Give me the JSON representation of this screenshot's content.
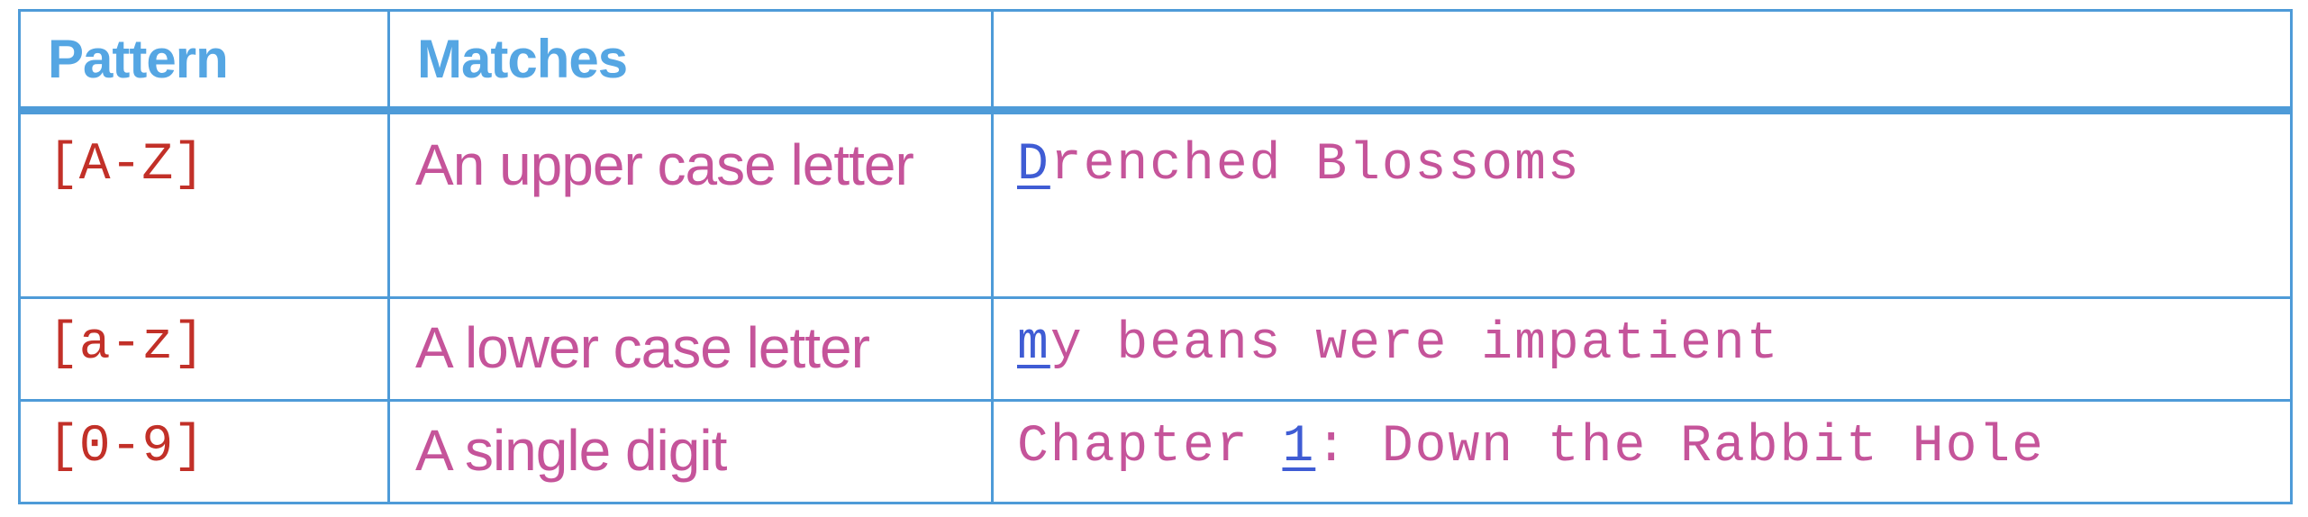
{
  "table": {
    "headers": [
      "Pattern",
      "Matches",
      ""
    ],
    "rows": [
      {
        "pattern": "[A-Z]",
        "matches": "An upper case letter",
        "example_match": "D",
        "example_rest": "renched Blossoms"
      },
      {
        "pattern": "[a-z]",
        "matches": "A lower case letter",
        "example_match": "m",
        "example_rest": "y beans were impatient"
      },
      {
        "pattern": "[0-9]",
        "matches": "A single digit",
        "example_before": "Chapter ",
        "example_match": "1",
        "example_rest": ": Down the Rabbit Hole"
      }
    ]
  },
  "colors": {
    "border": "#4e9bd8",
    "header_text": "#55a6e3",
    "pattern_text": "#c23028",
    "body_text": "#c5549a",
    "match_highlight": "#3f5cd4"
  }
}
